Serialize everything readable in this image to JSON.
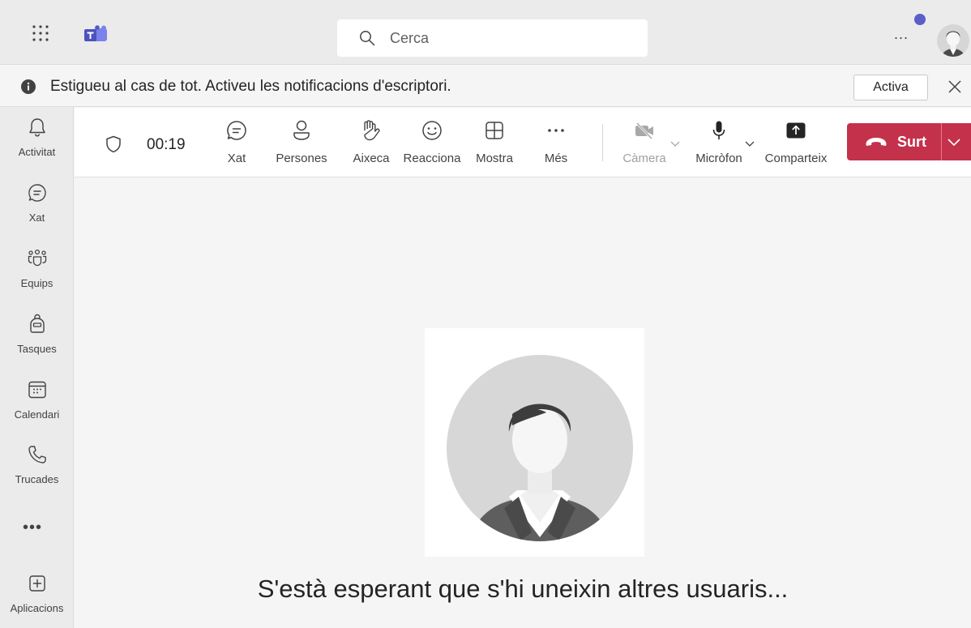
{
  "topbar": {
    "search_placeholder": "Cerca",
    "more_label": "...",
    "notification_dot_color": "#5b5fc7"
  },
  "banner": {
    "message": "Estigueu al cas de tot. Activeu les notificacions d'escriptori.",
    "activate_label": "Activa"
  },
  "sidebar": {
    "items": [
      {
        "label": "Activitat",
        "icon": "bell-icon"
      },
      {
        "label": "Xat",
        "icon": "chat-icon"
      },
      {
        "label": "Equips",
        "icon": "teams-icon"
      },
      {
        "label": "Tasques",
        "icon": "backpack-icon"
      },
      {
        "label": "Calendari",
        "icon": "calendar-icon"
      },
      {
        "label": "Trucades",
        "icon": "phone-icon"
      }
    ],
    "more_label": "•••",
    "apps_label": "Aplicacions"
  },
  "meeting": {
    "timer": "00:19",
    "buttons": {
      "chat": "Xat",
      "people": "Persones",
      "raise": "Aixeca",
      "react": "Reacciona",
      "view": "Mostra",
      "more": "Més",
      "camera": "Càmera",
      "mic": "Micròfon",
      "share": "Comparteix"
    },
    "leave_label": "Surt",
    "leave_color": "#c4314b"
  },
  "stage": {
    "waiting_message": "S'està esperant que s'hi uneixin altres usuaris..."
  }
}
